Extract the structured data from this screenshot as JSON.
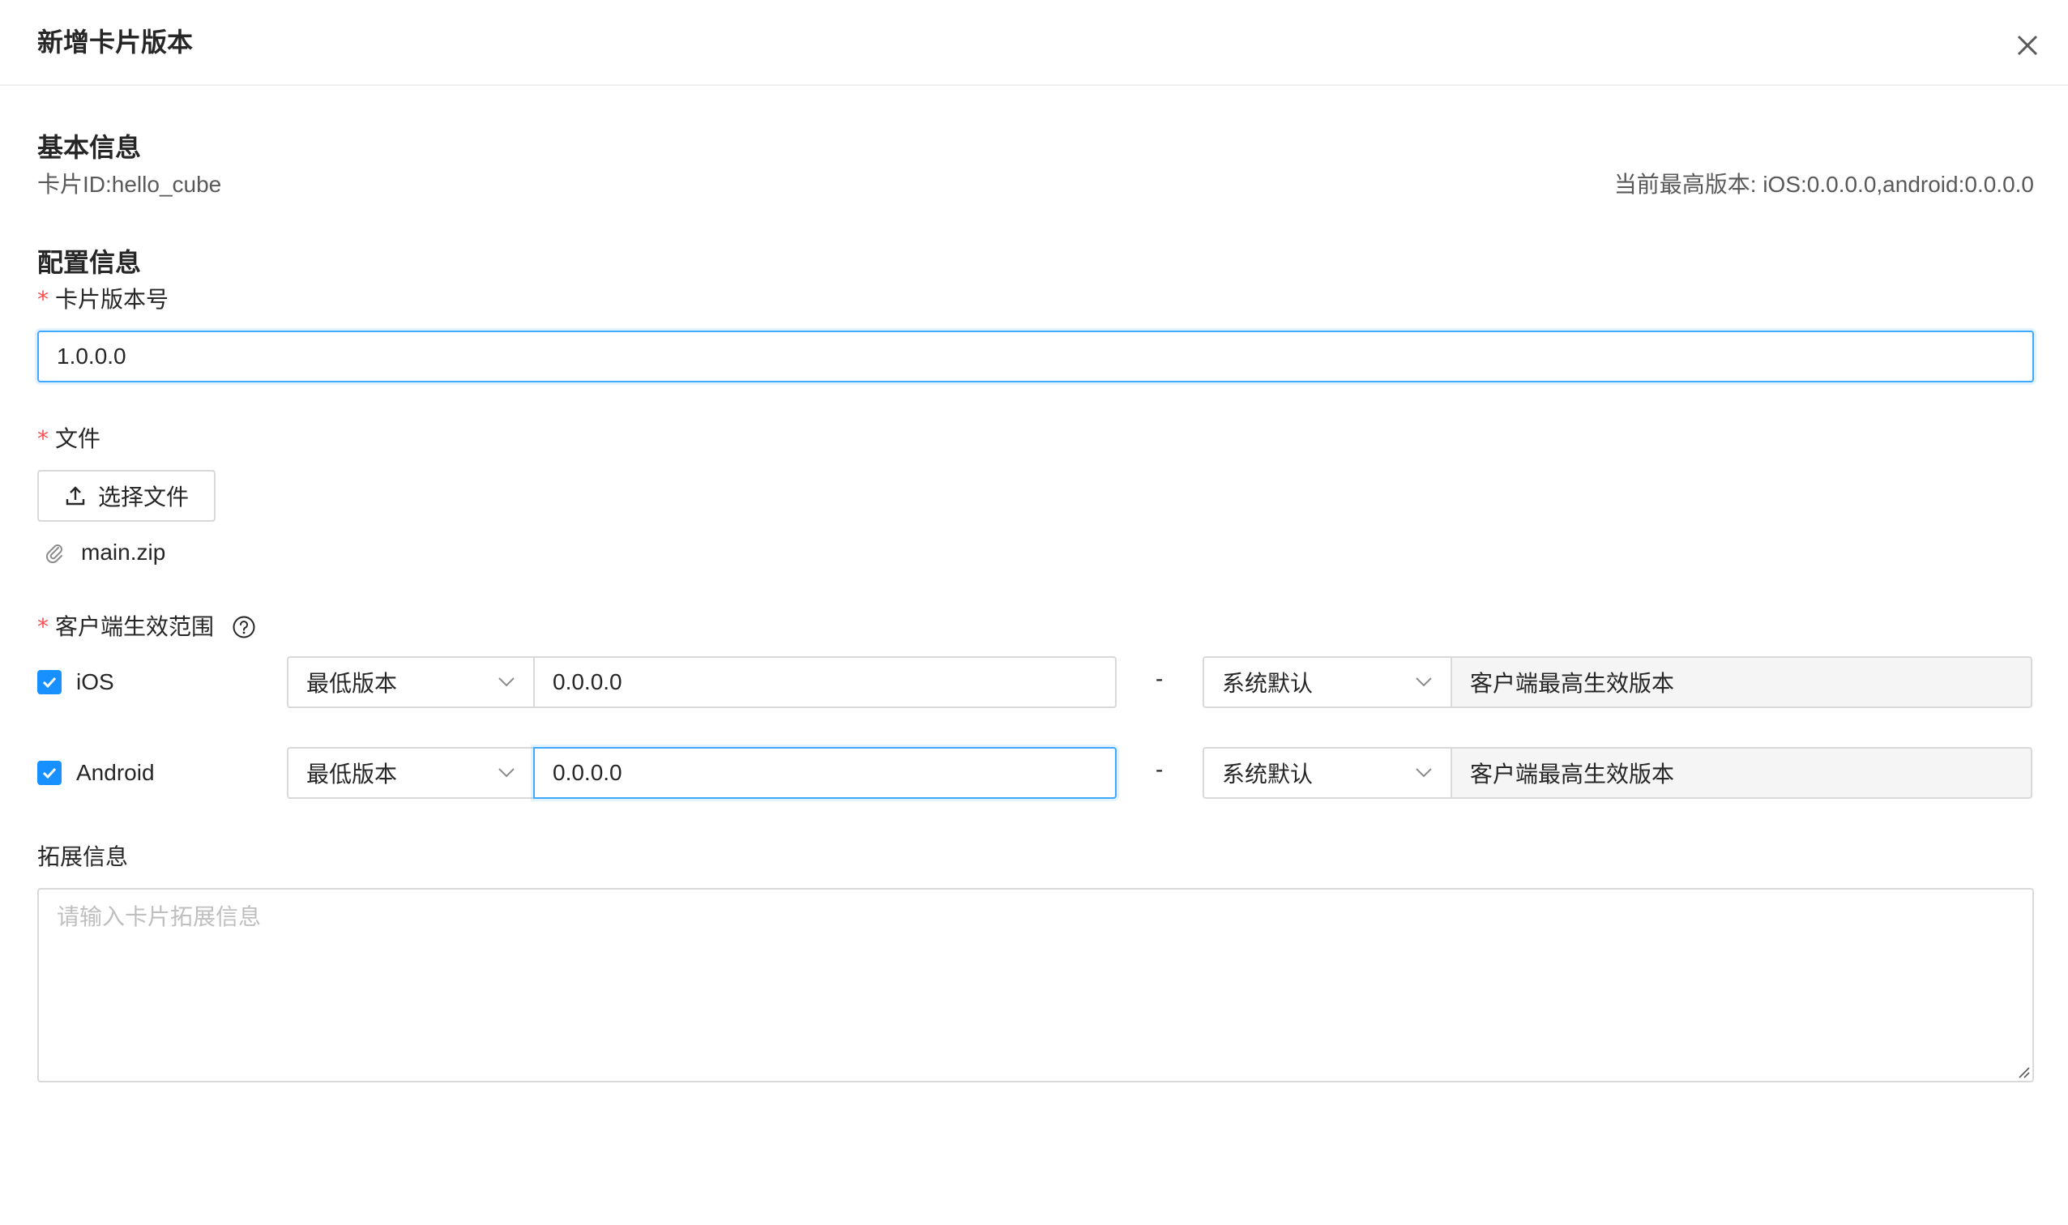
{
  "dialog": {
    "title": "新增卡片版本"
  },
  "basic_info": {
    "heading": "基本信息",
    "card_id": "卡片ID:hello_cube",
    "current_max_version": "当前最高版本: iOS:0.0.0.0,android:0.0.0.0"
  },
  "config_info": {
    "heading": "配置信息",
    "version_label": "卡片版本号",
    "version_value": "1.0.0.0",
    "file_label": "文件",
    "upload_button": "选择文件",
    "file_name": "main.zip",
    "scope_label": "客户端生效范围",
    "platforms": [
      {
        "name": "iOS",
        "checked": true,
        "min_select": "最低版本",
        "min_value": "0.0.0.0",
        "separator": "-",
        "max_select": "系统默认",
        "max_value": "客户端最高生效版本"
      },
      {
        "name": "Android",
        "checked": true,
        "min_select": "最低版本",
        "min_value": "0.0.0.0",
        "separator": "-",
        "max_select": "系统默认",
        "max_value": "客户端最高生效版本"
      }
    ],
    "ext_label": "拓展信息",
    "ext_placeholder": "请输入卡片拓展信息"
  },
  "colors": {
    "accent": "#1890ff",
    "required": "#ff4d4f",
    "focus_border": "#40a9ff",
    "disabled_bg": "#f5f5f5"
  },
  "icons": [
    "close-icon",
    "upload-icon",
    "paperclip-icon",
    "help-icon",
    "check-icon",
    "chevron-down-icon"
  ]
}
